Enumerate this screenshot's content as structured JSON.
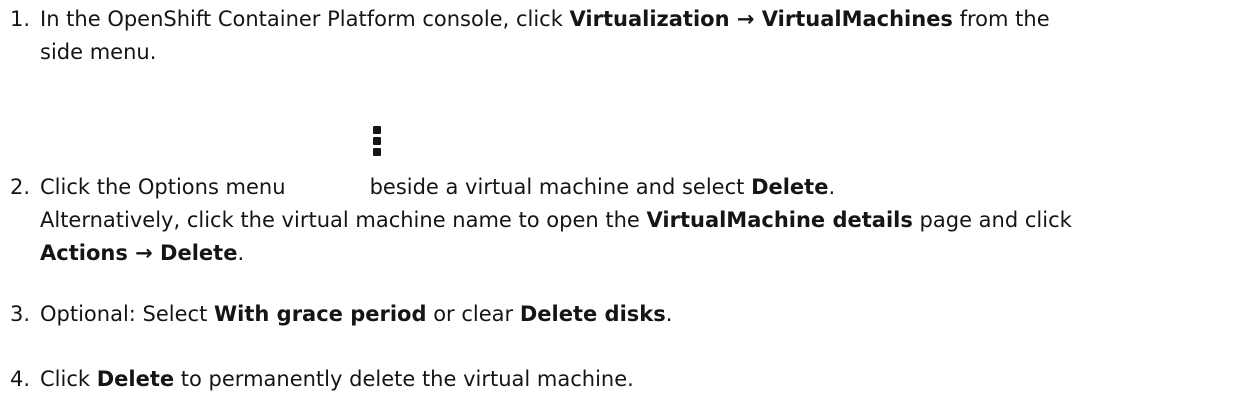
{
  "steps": [
    {
      "number": "1.",
      "line1_a": "In the OpenShift Container Platform console, click ",
      "line1_b": "Virtualization",
      "line1_arrow": " → ",
      "line1_c": "VirtualMachines",
      "line1_d": " from the",
      "line2": "side menu."
    },
    {
      "number": "2.",
      "line1_a": "Click the Options menu",
      "line1_b": "beside a virtual machine and select ",
      "line1_c": "Delete",
      "line1_d": ".",
      "line2_a": "Alternatively, click the virtual machine name to open the ",
      "line2_b": "VirtualMachine details",
      "line2_c": " page and click",
      "line3_a": "Actions",
      "line3_arrow": " → ",
      "line3_b": "Delete",
      "line3_c": "."
    },
    {
      "number": "3.",
      "a": "Optional: Select ",
      "b": "With grace period",
      "c": " or clear ",
      "d": "Delete disks",
      "e": "."
    },
    {
      "number": "4.",
      "a": "Click ",
      "b": "Delete",
      "c": " to permanently delete the virtual machine."
    }
  ],
  "icons": {
    "options_menu": "kebab-icon"
  }
}
